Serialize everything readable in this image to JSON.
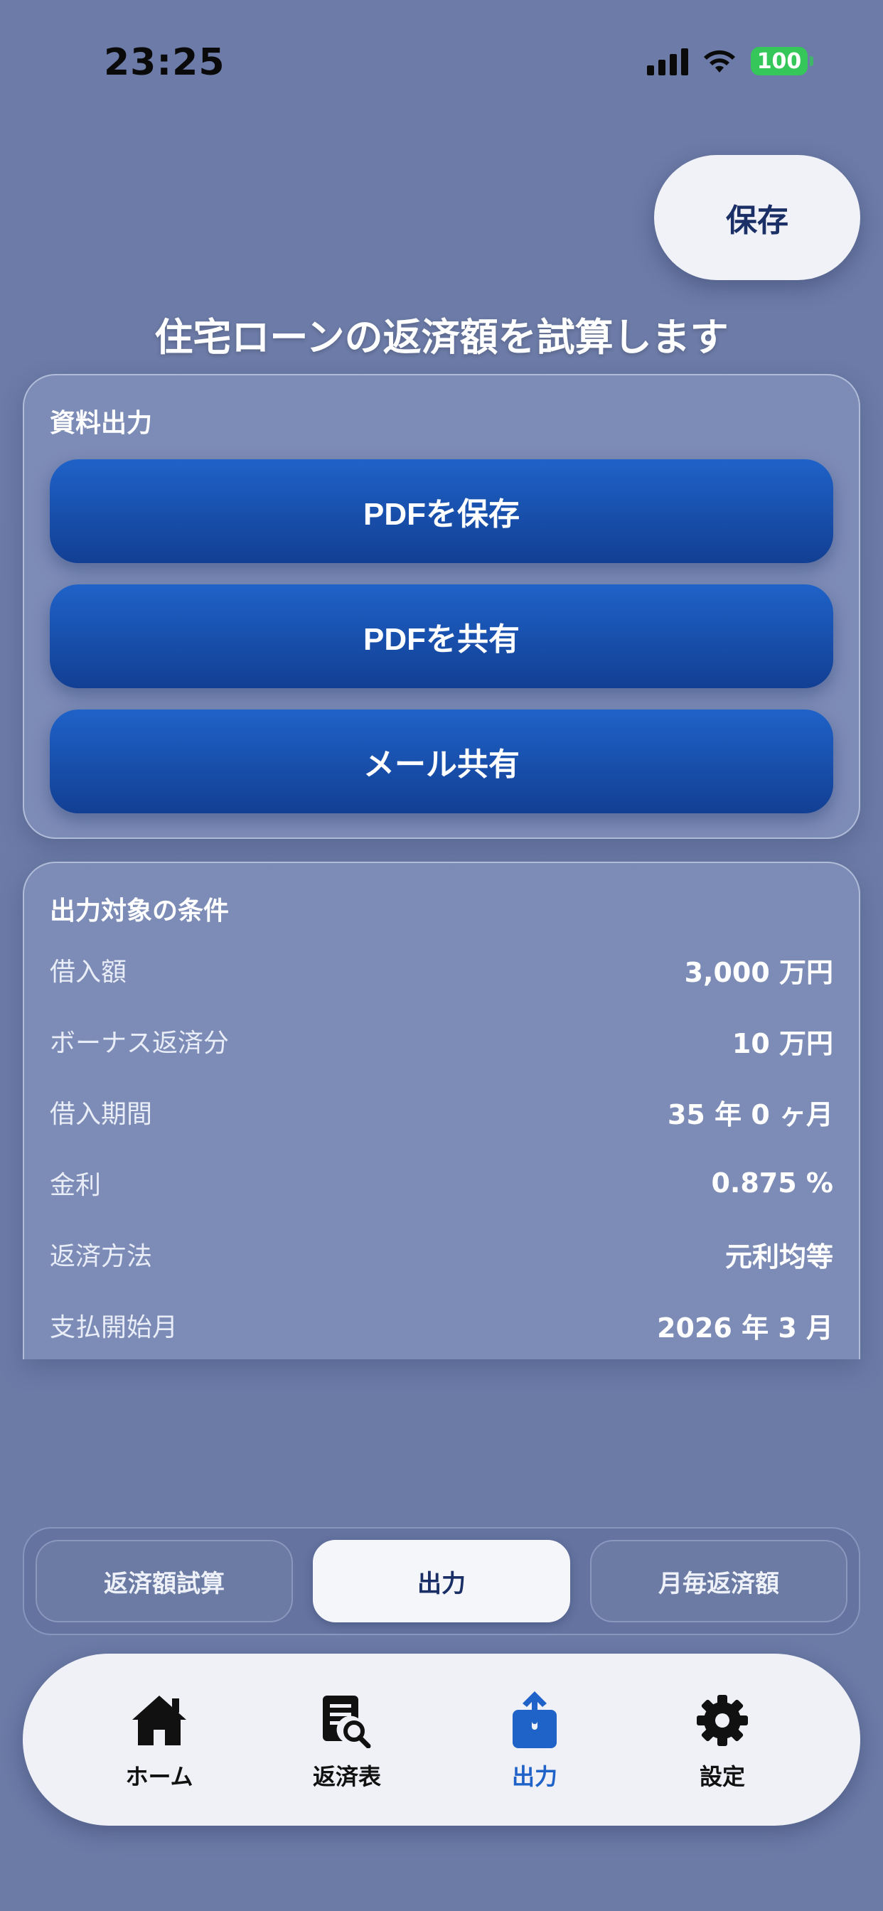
{
  "status_bar": {
    "time": "23:25",
    "battery": "100"
  },
  "header": {
    "save_label": "保存",
    "title": "住宅ローンの返済額を試算します"
  },
  "export_section": {
    "title": "資料出力",
    "buttons": [
      "PDFを保存",
      "PDFを共有",
      "メール共有"
    ]
  },
  "conditions_section": {
    "title": "出力対象の条件",
    "rows": [
      {
        "label": "借入額",
        "value": "3,000 万円"
      },
      {
        "label": "ボーナス返済分",
        "value": "10 万円"
      },
      {
        "label": "借入期間",
        "value": "35 年 0 ヶ月"
      },
      {
        "label": "金利",
        "value": "0.875 %"
      },
      {
        "label": "返済方法",
        "value": "元利均等"
      },
      {
        "label": "支払開始月",
        "value": "2026 年 3 月"
      }
    ]
  },
  "segment": {
    "options": [
      "返済額試算",
      "出力",
      "月毎返済額"
    ],
    "selected": "出力"
  },
  "tabbar": {
    "items": [
      {
        "label": "ホーム",
        "icon": "house-icon"
      },
      {
        "label": "返済表",
        "icon": "document-search-icon"
      },
      {
        "label": "出力",
        "icon": "share-icon"
      },
      {
        "label": "設定",
        "icon": "gear-icon"
      }
    ],
    "active": "出力"
  },
  "colors": {
    "accent": "#1f62c8",
    "background": "#6b7ca8",
    "battery": "#35c759"
  }
}
